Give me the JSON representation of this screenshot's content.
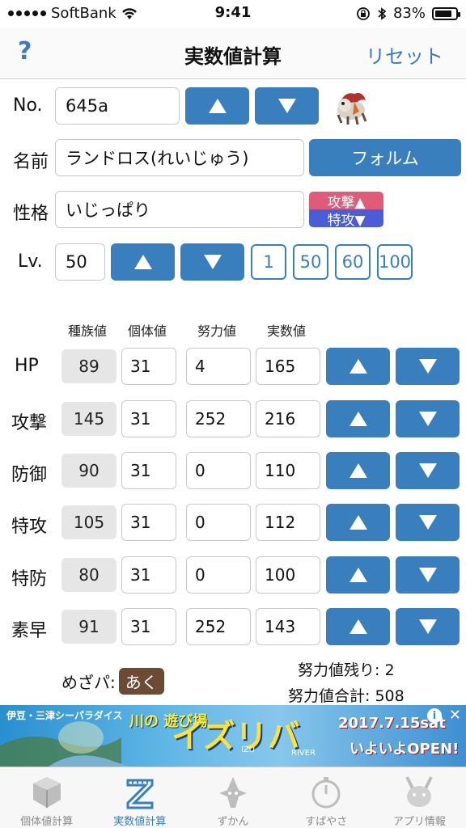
{
  "status": {
    "carrier": "SoftBank",
    "time": "9:41",
    "battery": "83%",
    "battery_level": 0.83
  },
  "nav": {
    "help": "?",
    "title": "実数値計算",
    "reset": "リセット"
  },
  "form": {
    "no_label": "No.",
    "no_value": "645a",
    "name_label": "名前",
    "name_value": "ランドロス(れいじゅう)",
    "form_button": "フォルム",
    "nature_label": "性格",
    "nature_value": "いじっぱり",
    "nature_up": "攻撃▲",
    "nature_down": "特攻▼",
    "lv_label": "Lv.",
    "lv_value": "50",
    "lv_presets": [
      "1",
      "50",
      "60",
      "100"
    ]
  },
  "stats": {
    "headers": {
      "base": "種族値",
      "iv": "個体値",
      "ev": "努力値",
      "actual": "実数値"
    },
    "rows": [
      {
        "name": "HP",
        "base": "89",
        "iv": "31",
        "ev": "4",
        "actual": "165"
      },
      {
        "name": "攻撃",
        "base": "145",
        "iv": "31",
        "ev": "252",
        "actual": "216"
      },
      {
        "name": "防御",
        "base": "90",
        "iv": "31",
        "ev": "0",
        "actual": "110"
      },
      {
        "name": "特攻",
        "base": "105",
        "iv": "31",
        "ev": "0",
        "actual": "112"
      },
      {
        "name": "特防",
        "base": "80",
        "iv": "31",
        "ev": "0",
        "actual": "100"
      },
      {
        "name": "素早",
        "base": "91",
        "iv": "31",
        "ev": "252",
        "actual": "143"
      }
    ]
  },
  "summary": {
    "mezapa_label": "めざパ:",
    "mezapa_type": "あく",
    "ev_remaining": "努力値残り: 2",
    "ev_total": "努力値合計: 508"
  },
  "ad": {
    "brand": "伊豆・三津シーパラダイス",
    "kawa": "川の 遊び場",
    "headline": "イズリバ",
    "sub1": "IZU",
    "sub2": "RIVER",
    "date": "2017.7.15sat",
    "open": "いよいよOPEN!"
  },
  "tabs": [
    {
      "label": "個体値計算",
      "icon": "box-icon"
    },
    {
      "label": "実数値計算",
      "icon": "ruler-icon"
    },
    {
      "label": "ずかん",
      "icon": "pokedex-icon"
    },
    {
      "label": "すばやさ",
      "icon": "stopwatch-icon"
    },
    {
      "label": "アプリ情報",
      "icon": "pikachu-icon"
    }
  ],
  "colors": {
    "accent": "#3a7fbd",
    "nature_up": "#e05a7a",
    "nature_down": "#4a5cd6",
    "type_dark": "#6b4a36"
  }
}
